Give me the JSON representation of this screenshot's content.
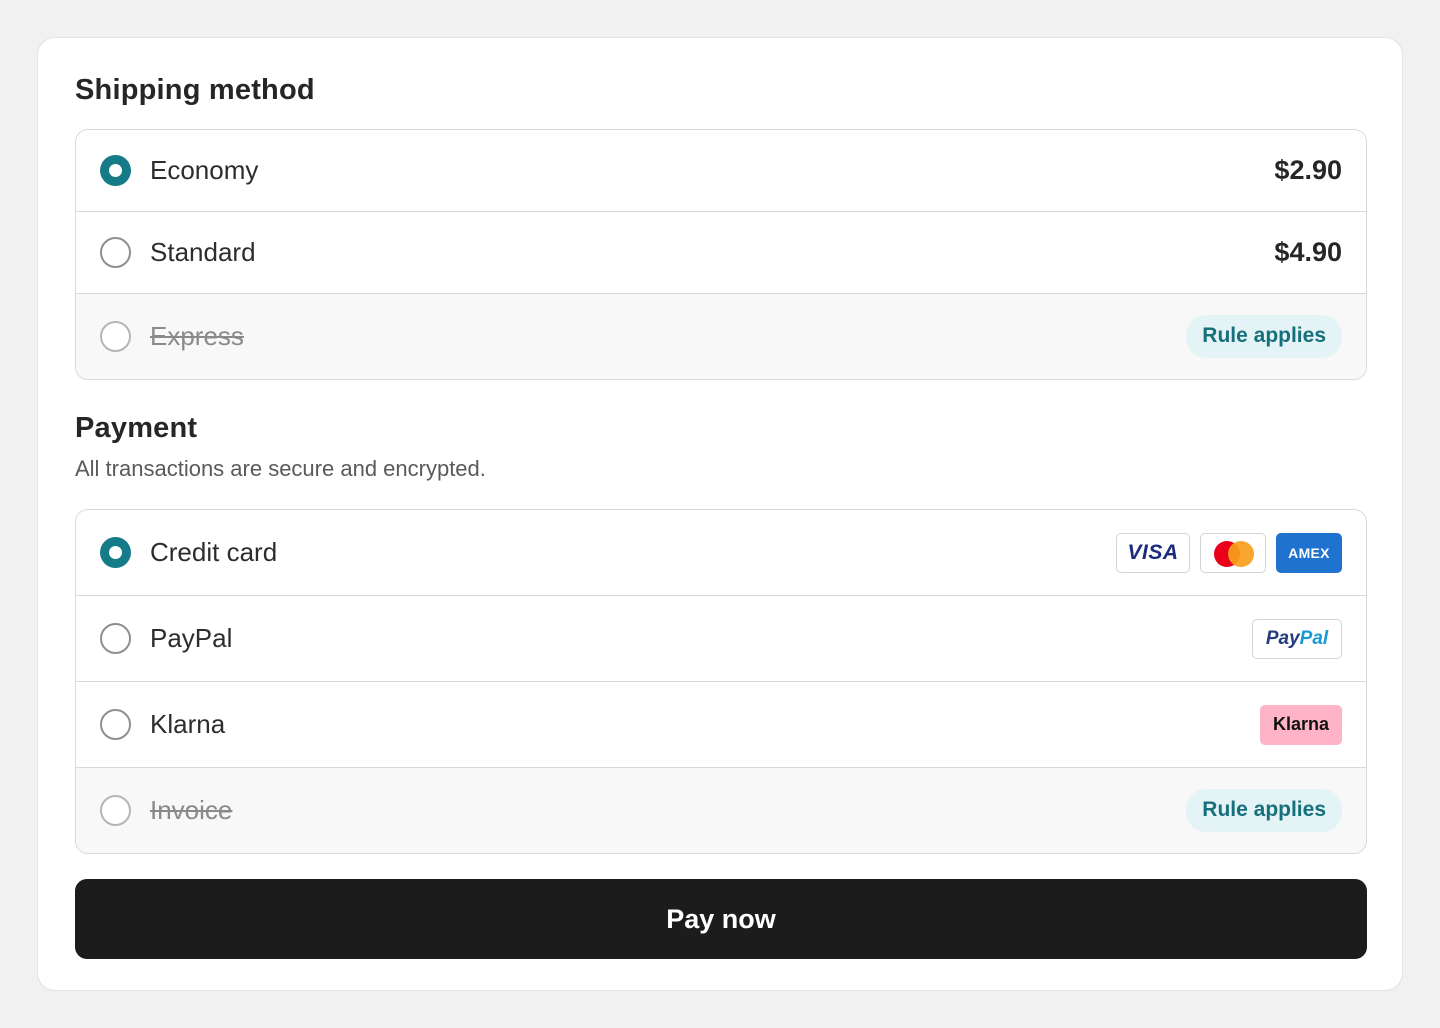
{
  "shipping": {
    "title": "Shipping method",
    "options": [
      {
        "label": "Economy",
        "price": "$2.90",
        "selected": true,
        "disabled": false
      },
      {
        "label": "Standard",
        "price": "$4.90",
        "selected": false,
        "disabled": false
      },
      {
        "label": "Express",
        "badge": "Rule applies",
        "selected": false,
        "disabled": true
      }
    ]
  },
  "payment": {
    "title": "Payment",
    "subtitle": "All transactions are secure and encrypted.",
    "options": [
      {
        "label": "Credit card",
        "selected": true,
        "disabled": false,
        "logos": [
          "VISA",
          "mastercard-icon",
          "AMEX"
        ]
      },
      {
        "label": "PayPal",
        "selected": false,
        "disabled": false,
        "logo_part1": "Pay",
        "logo_part2": "Pal"
      },
      {
        "label": "Klarna",
        "selected": false,
        "disabled": false,
        "logo": "Klarna"
      },
      {
        "label": "Invoice",
        "badge": "Rule applies",
        "selected": false,
        "disabled": true
      }
    ]
  },
  "pay_button": "Pay now",
  "colors": {
    "accent": "#167b88",
    "badge_bg": "#e4f3f5",
    "badge_text": "#16707c",
    "button_bg": "#1c1c1c",
    "amex": "#1f72cd",
    "klarna": "#ffb3c7"
  }
}
